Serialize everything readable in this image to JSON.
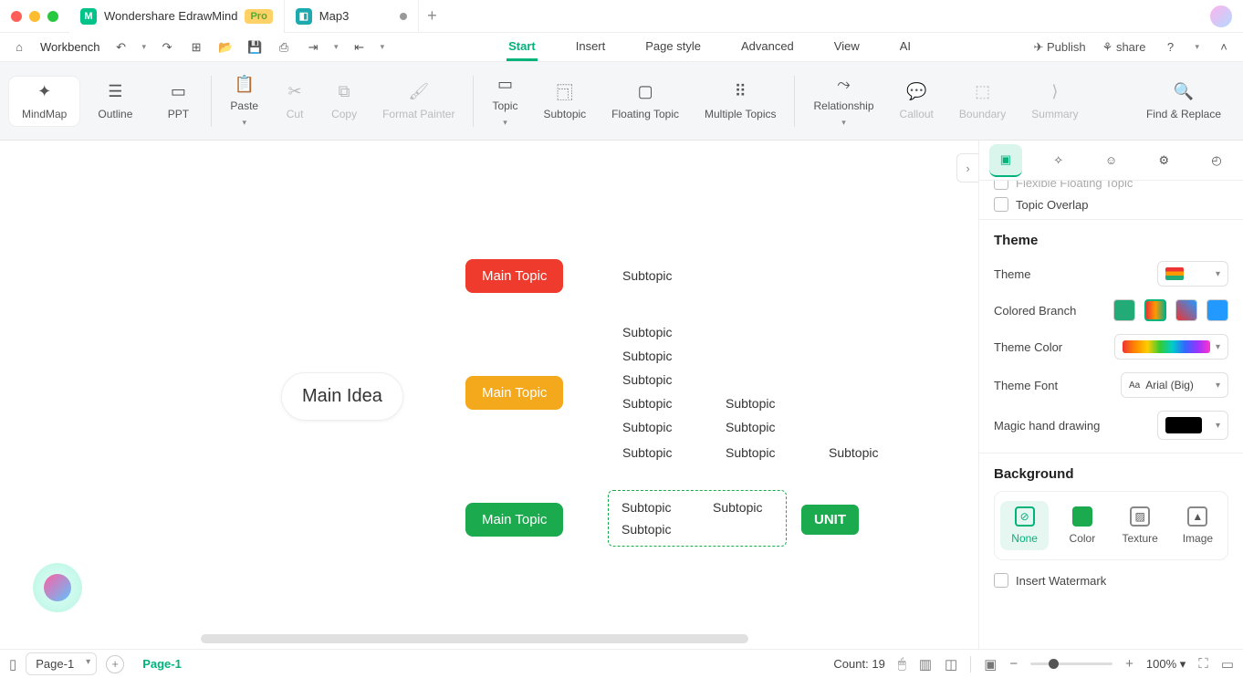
{
  "titlebar": {
    "app_name": "Wondershare EdrawMind",
    "pro_badge": "Pro",
    "tab2_name": "Map3"
  },
  "tb1": {
    "workbench": "Workbench",
    "menus": [
      "Start",
      "Insert",
      "Page style",
      "Advanced",
      "View",
      "AI"
    ],
    "publish": "Publish",
    "share": "share"
  },
  "ribbon": {
    "views": [
      "MindMap",
      "Outline",
      "PPT"
    ],
    "paste": "Paste",
    "cut": "Cut",
    "copy": "Copy",
    "format_painter": "Format Painter",
    "topic": "Topic",
    "subtopic": "Subtopic",
    "floating_topic": "Floating Topic",
    "multiple_topics": "Multiple Topics",
    "relationship": "Relationship",
    "callout": "Callout",
    "boundary": "Boundary",
    "summary": "Summary",
    "find_replace": "Find & Replace"
  },
  "mindmap": {
    "main_idea": "Main Idea",
    "main_topic": "Main Topic",
    "subtopic": "Subtopic",
    "unit": "UNIT"
  },
  "panel": {
    "flexible_floating": "Flexible Floating Topic",
    "topic_overlap": "Topic Overlap",
    "theme_h": "Theme",
    "theme": "Theme",
    "colored_branch": "Colored Branch",
    "theme_color": "Theme Color",
    "theme_font": "Theme Font",
    "theme_font_val": "Arial (Big)",
    "magic_hand": "Magic hand drawing",
    "background_h": "Background",
    "bg_none": "None",
    "bg_color": "Color",
    "bg_texture": "Texture",
    "bg_image": "Image",
    "insert_watermark": "Insert Watermark"
  },
  "status": {
    "page_dd": "Page-1",
    "page_tab": "Page-1",
    "count": "Count: 19",
    "zoom": "100%"
  }
}
